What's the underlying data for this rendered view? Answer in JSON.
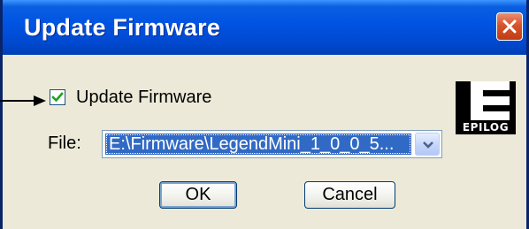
{
  "window": {
    "title": "Update Firmware"
  },
  "update_checkbox": {
    "label": "Update Firmware",
    "checked": true
  },
  "logo": {
    "text": "EPILOG"
  },
  "file": {
    "label": "File:",
    "value": "E:\\Firmware\\LegendMini_1_0_0_5..."
  },
  "buttons": {
    "ok": "OK",
    "cancel": "Cancel"
  },
  "colors": {
    "titlebar": "#0054e3",
    "close_button": "#d6532c",
    "dialog_background": "#ece9d8",
    "selection": "#316ac5"
  },
  "icons": {
    "close": "close-icon",
    "checkmark": "checkmark-icon",
    "dropdown": "chevron-down-icon",
    "annotation_arrow": "arrow-right-icon"
  }
}
